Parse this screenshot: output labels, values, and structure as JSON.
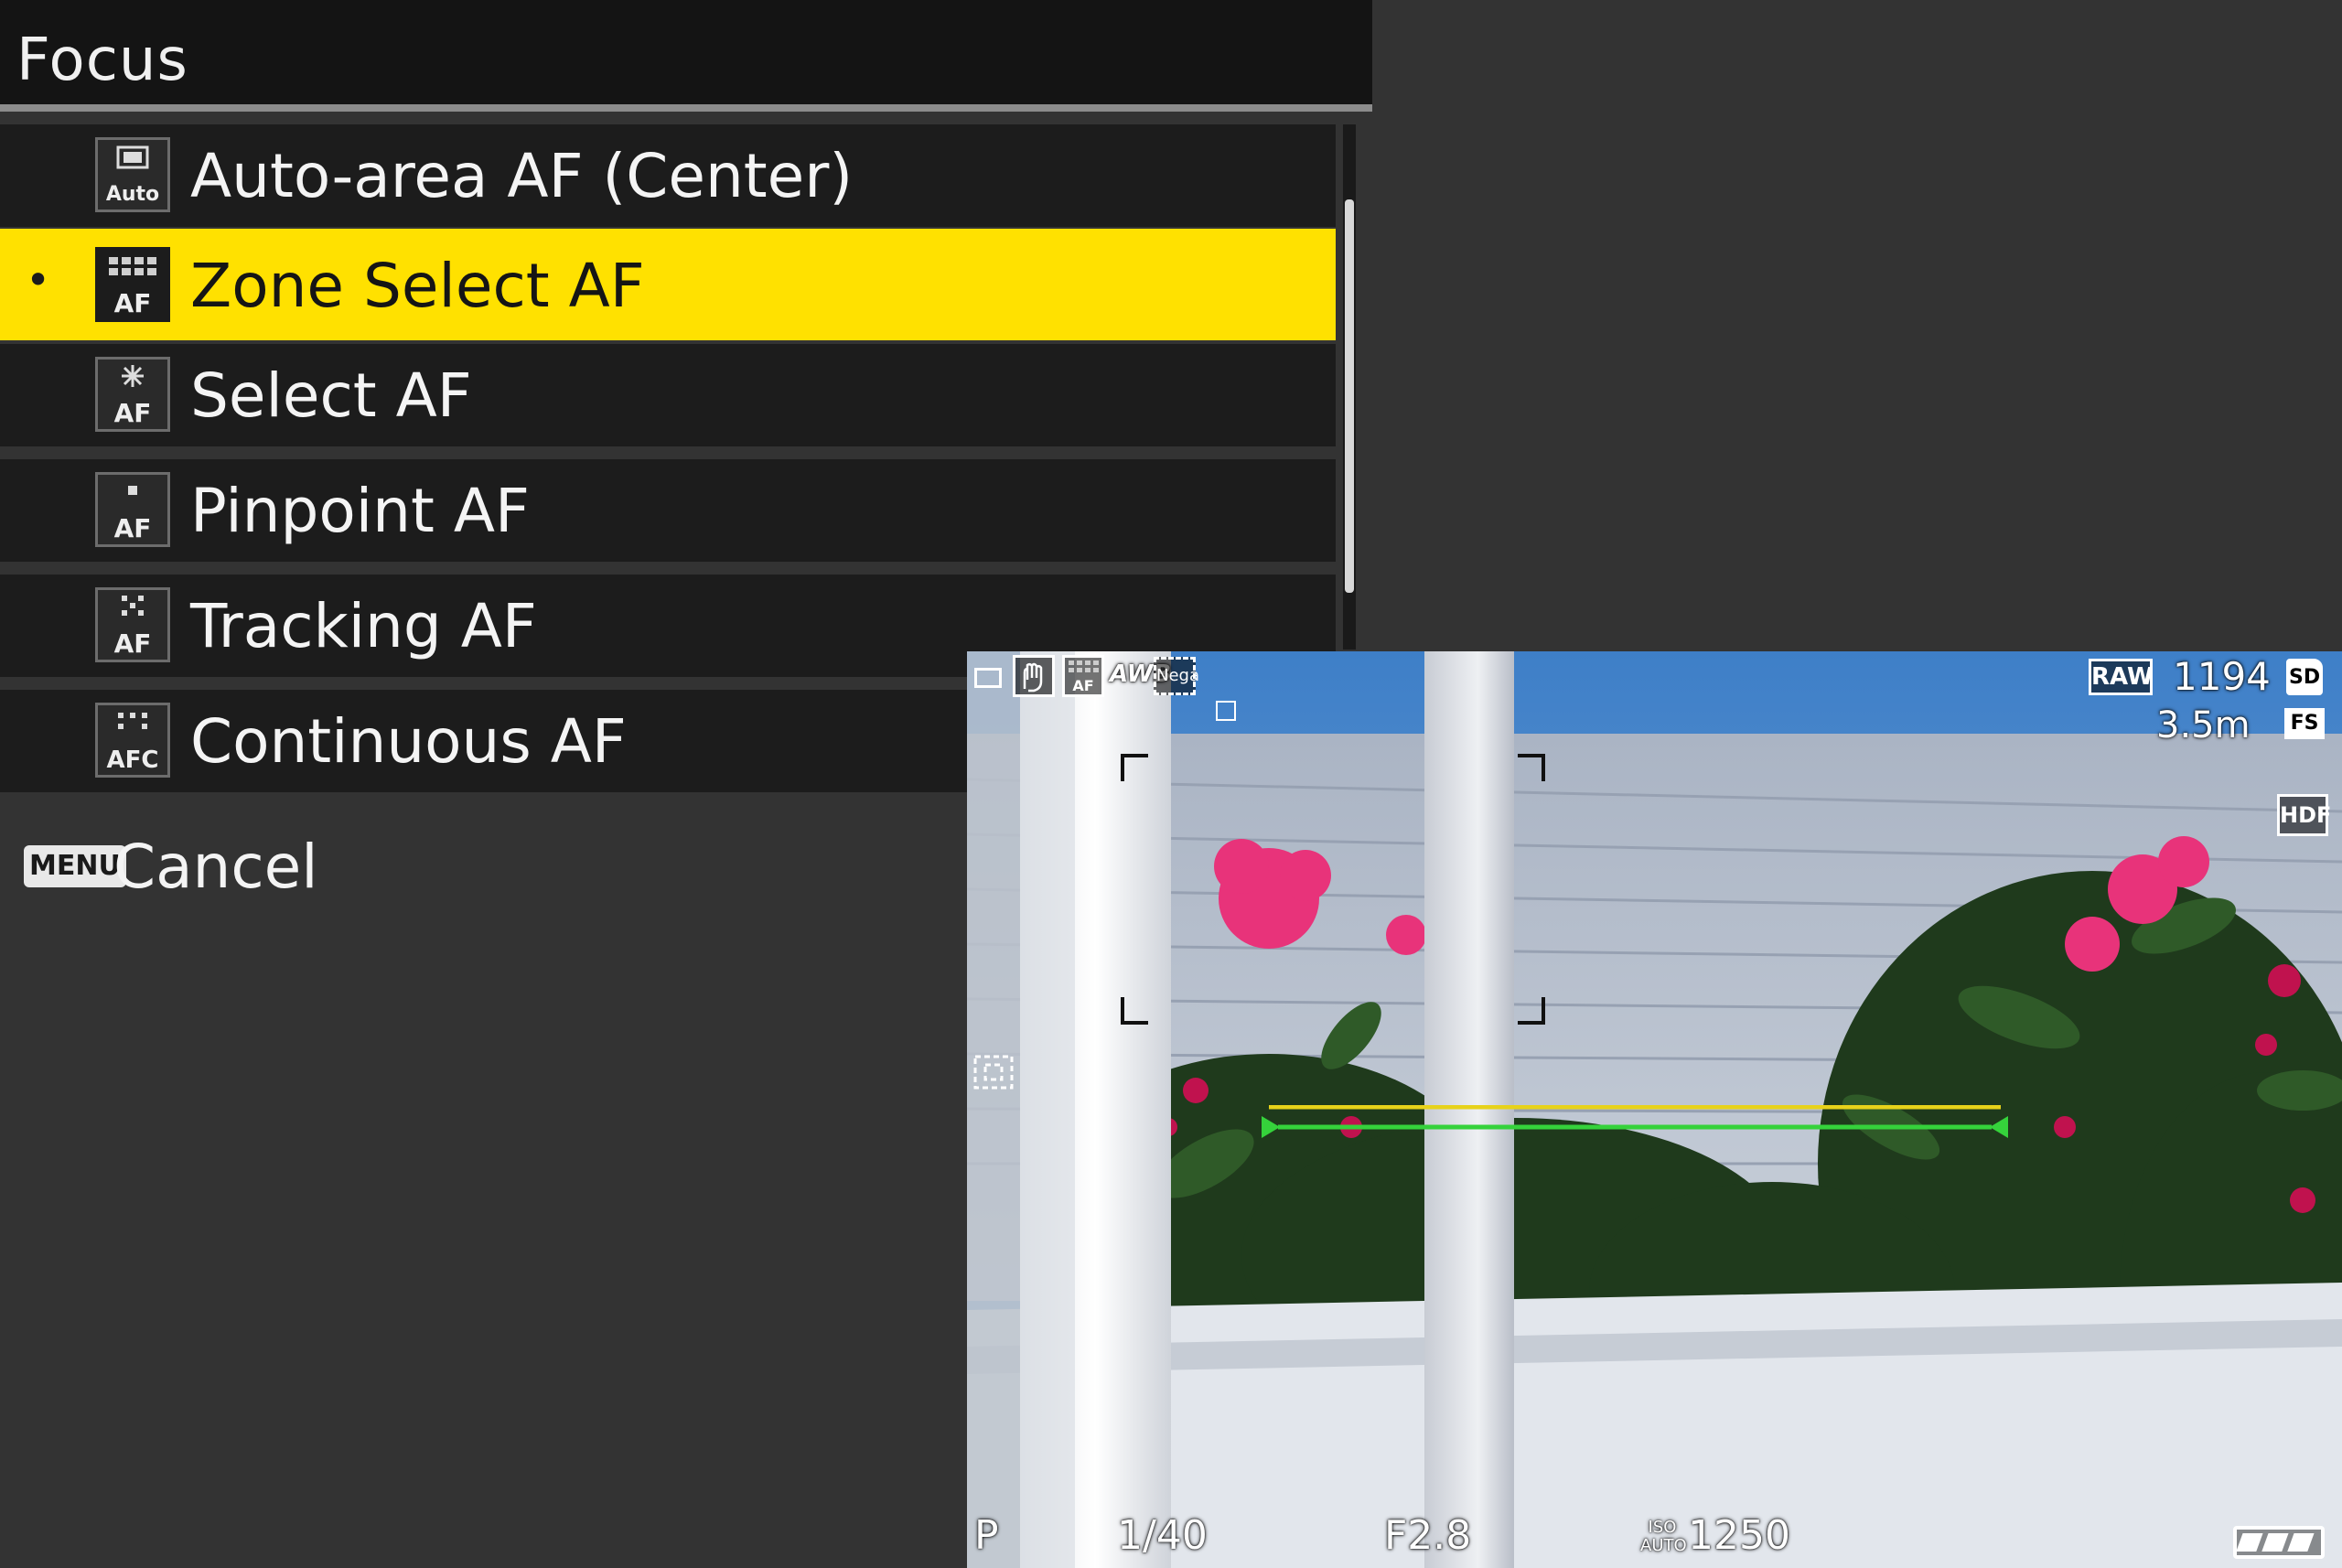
{
  "menu": {
    "title": "Focus",
    "items": [
      {
        "label": "Auto-area AF (Center)",
        "icon": "auto-area-af-icon",
        "selected": false
      },
      {
        "label": "Zone Select AF",
        "icon": "zone-select-af-icon",
        "selected": true,
        "bullet": "•"
      },
      {
        "label": "Select AF",
        "icon": "select-af-icon",
        "selected": false
      },
      {
        "label": "Pinpoint AF",
        "icon": "pinpoint-af-icon",
        "selected": false
      },
      {
        "label": "Tracking AF",
        "icon": "tracking-af-icon",
        "selected": false
      },
      {
        "label": "Continuous AF",
        "icon": "continuous-af-icon",
        "selected": false
      }
    ],
    "cancel": {
      "key": "MENU",
      "label": "Cancel"
    },
    "colors": {
      "selected_bg": "#ffe100",
      "row_bg": "#1c1c1c",
      "page_bg": "#333333"
    }
  },
  "preview": {
    "raw_badge": "RAW",
    "shots_remaining": "1194",
    "card_badge": "SD",
    "focus_distance": "3.5m",
    "fs_badge": "FS",
    "hdf_badge": "HDF",
    "nega_badge": "Nega",
    "af_badge": "AF",
    "mode": "P",
    "shutter": "1/40",
    "aperture": "F2.8",
    "iso_label": "ISO AUTO",
    "iso_value": "1250",
    "icons": [
      "frame-icon",
      "shake-reduction-icon",
      "zone-af-icon",
      "wb-auto-icon",
      "nega-film-icon",
      "af-zone-target-icon",
      "battery-icon"
    ]
  }
}
